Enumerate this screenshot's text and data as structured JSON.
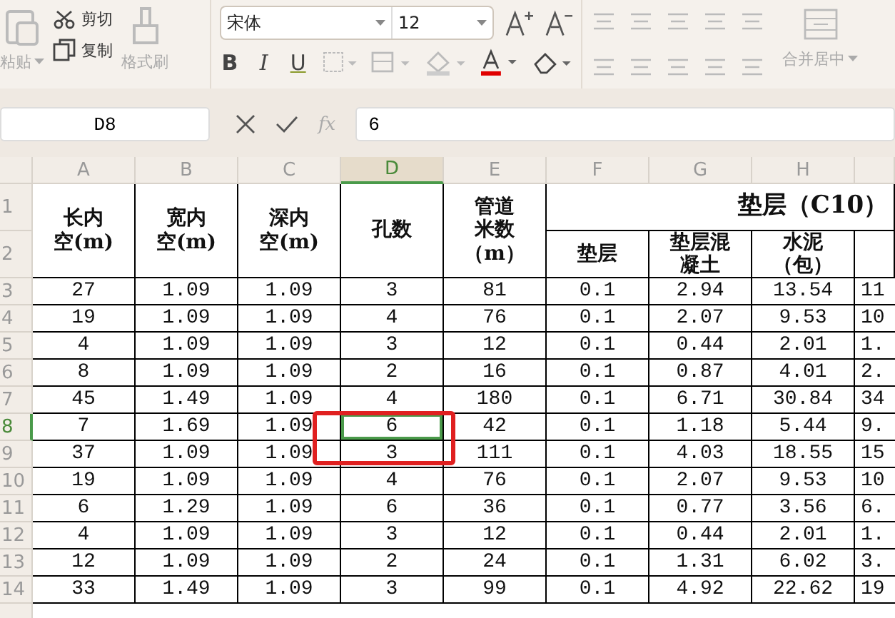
{
  "ribbon": {
    "paste": "粘贴",
    "cut": "剪切",
    "copy": "复制",
    "format_painter": "格式刷",
    "font_family": "宋体",
    "font_size": "12",
    "bold": "B",
    "italic": "I",
    "underline": "U",
    "merge": "合并居中"
  },
  "formula_bar": {
    "cell_ref": "D8",
    "fx": "fx",
    "value": "6"
  },
  "sheet": {
    "columns": [
      {
        "label": "A",
        "selected": false
      },
      {
        "label": "B",
        "selected": false
      },
      {
        "label": "C",
        "selected": false
      },
      {
        "label": "D",
        "selected": true
      },
      {
        "label": "E",
        "selected": false
      },
      {
        "label": "F",
        "selected": false
      },
      {
        "label": "G",
        "selected": false
      },
      {
        "label": "H",
        "selected": false
      }
    ],
    "header_row_numbers": [
      "1",
      "2"
    ],
    "headers_merged": [
      [
        "长内",
        "空(m)"
      ],
      [
        "宽内",
        "空(m)"
      ],
      [
        "深内",
        "空(m)"
      ],
      [
        "孔数"
      ],
      [
        "管道",
        "米数",
        "（m）"
      ]
    ],
    "group_title": "垫层（C10）",
    "sub_headers": [
      [
        "垫层"
      ],
      [
        "垫层混",
        "凝土"
      ],
      [
        "水泥",
        "（包）"
      ]
    ],
    "rows": [
      {
        "num": "3",
        "selected": false,
        "cells": [
          "27",
          "1.09",
          "1.09",
          "3",
          "81",
          "0.1",
          "2.94",
          "13.54",
          "11"
        ]
      },
      {
        "num": "4",
        "selected": false,
        "cells": [
          "19",
          "1.09",
          "1.09",
          "4",
          "76",
          "0.1",
          "2.07",
          "9.53",
          "10"
        ]
      },
      {
        "num": "5",
        "selected": false,
        "cells": [
          "4",
          "1.09",
          "1.09",
          "3",
          "12",
          "0.1",
          "0.44",
          "2.01",
          "1."
        ]
      },
      {
        "num": "6",
        "selected": false,
        "cells": [
          "8",
          "1.09",
          "1.09",
          "2",
          "16",
          "0.1",
          "0.87",
          "4.01",
          "2."
        ]
      },
      {
        "num": "7",
        "selected": false,
        "cells": [
          "45",
          "1.49",
          "1.09",
          "4",
          "180",
          "0.1",
          "6.71",
          "30.84",
          "34"
        ]
      },
      {
        "num": "8",
        "selected": true,
        "cells": [
          "7",
          "1.69",
          "1.09",
          "6",
          "42",
          "0.1",
          "1.18",
          "5.44",
          "9."
        ]
      },
      {
        "num": "9",
        "selected": false,
        "cells": [
          "37",
          "1.09",
          "1.09",
          "3",
          "111",
          "0.1",
          "4.03",
          "18.55",
          "15"
        ]
      },
      {
        "num": "10",
        "selected": false,
        "cells": [
          "19",
          "1.09",
          "1.09",
          "4",
          "76",
          "0.1",
          "2.07",
          "9.53",
          "10"
        ]
      },
      {
        "num": "11",
        "selected": false,
        "cells": [
          "6",
          "1.29",
          "1.09",
          "6",
          "36",
          "0.1",
          "0.77",
          "3.56",
          "6."
        ]
      },
      {
        "num": "12",
        "selected": false,
        "cells": [
          "4",
          "1.09",
          "1.09",
          "3",
          "12",
          "0.1",
          "0.44",
          "2.01",
          "1."
        ]
      },
      {
        "num": "13",
        "selected": false,
        "cells": [
          "12",
          "1.09",
          "1.09",
          "2",
          "24",
          "0.1",
          "1.31",
          "6.02",
          "3."
        ]
      },
      {
        "num": "14",
        "selected": false,
        "cells": [
          "33",
          "1.49",
          "1.09",
          "3",
          "99",
          "0.1",
          "4.92",
          "22.62",
          "19"
        ]
      }
    ]
  }
}
